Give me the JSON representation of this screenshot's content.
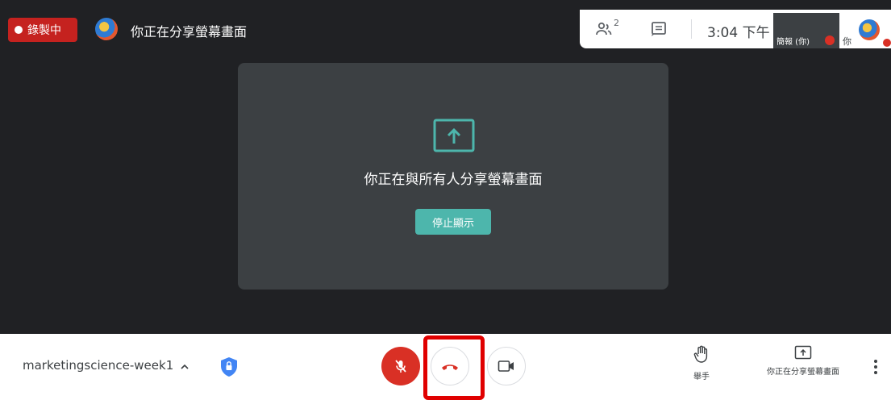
{
  "recording": {
    "label": "錄製中"
  },
  "presenter": {
    "title": "你正在分享螢幕畫面"
  },
  "toolbar": {
    "people_count": "2",
    "people_icon": "people-icon",
    "chat_icon": "chat-icon",
    "time": "3:04 下午",
    "self_tile_name": "簡報 (你)",
    "self_label": "你"
  },
  "share_card": {
    "message": "你正在與所有人分享螢幕畫面",
    "stop_label": "停止顯示"
  },
  "bottom_bar": {
    "meeting_name": "marketingscience-week1",
    "raise_hand_label": "舉手",
    "presenting_label": "你正在分享螢幕畫面"
  },
  "colors": {
    "stage_bg": "#202124",
    "card_bg": "#3c4043",
    "accent_teal": "#4db6ac",
    "record_red": "#c5221f",
    "mic_off_red": "#d93025",
    "highlight_red": "#e00000"
  }
}
